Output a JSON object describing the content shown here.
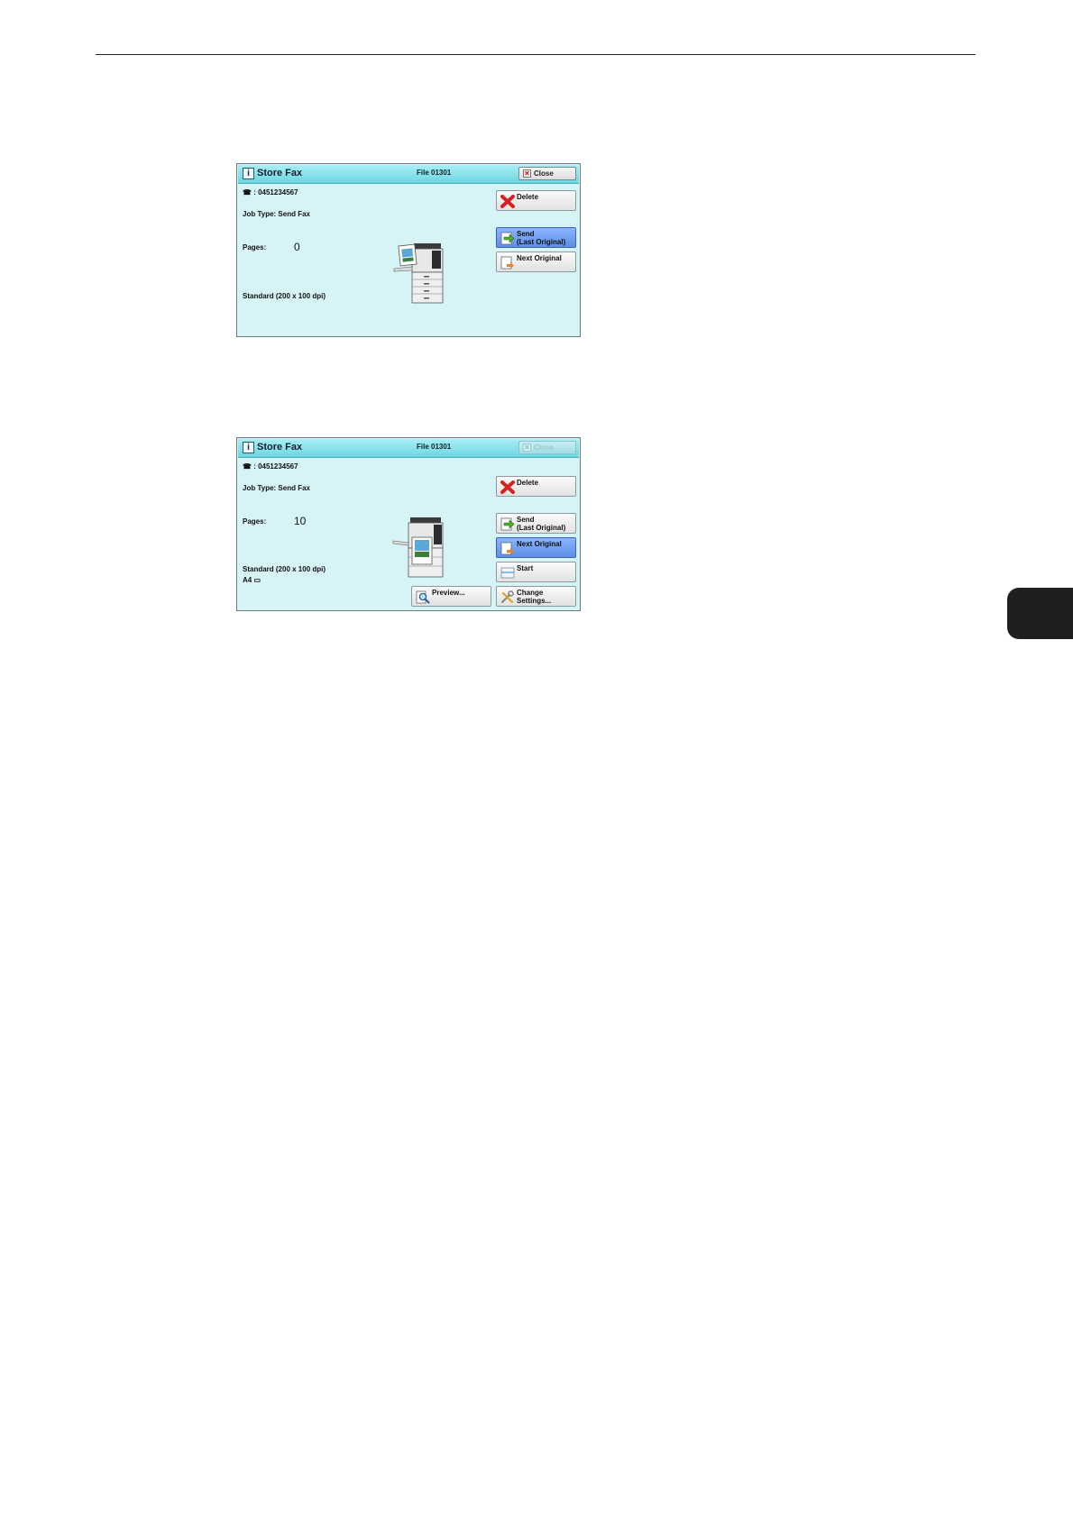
{
  "screens": [
    {
      "title": "Store Fax",
      "file": "File 01301",
      "close_label": "Close",
      "close_enabled": true,
      "phone": "☎ : 0451234567",
      "job_type": "Job Type: Send Fax",
      "pages_label": "Pages:",
      "pages_value": "0",
      "resolution": "Standard (200 x 100 dpi)",
      "paper": "",
      "buttons": {
        "delete": "Delete",
        "send_line1": "Send",
        "send_line2": "(Last Original)",
        "next_original": "Next Original"
      }
    },
    {
      "title": "Store Fax",
      "file": "File 01301",
      "close_label": "Close",
      "close_enabled": false,
      "phone": "☎ : 0451234567",
      "job_type": "Job Type: Send Fax",
      "pages_label": "Pages:",
      "pages_value": "10",
      "resolution": "Standard (200 x 100 dpi)",
      "paper": "A4 ▭",
      "buttons": {
        "delete": "Delete",
        "send_line1": "Send",
        "send_line2": "(Last Original)",
        "next_original": "Next Original",
        "start": "Start",
        "change_line1": "Change",
        "change_line2": "Settings...",
        "preview": "Preview..."
      }
    }
  ],
  "colors": {
    "panel_bg": "#d6f3f6",
    "titlebar": "#6cd6e2",
    "selected_button": "#5d8fe6",
    "chapter_tab": "#1f1f1f"
  }
}
